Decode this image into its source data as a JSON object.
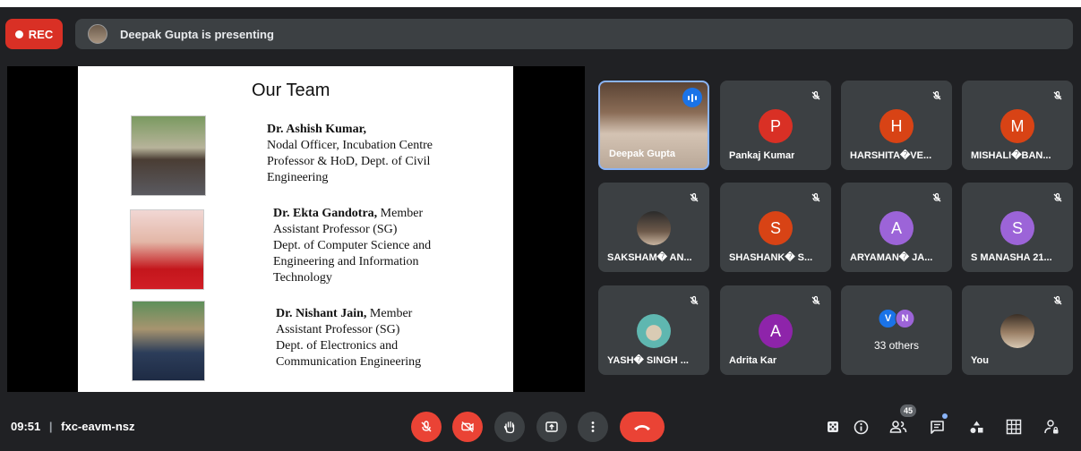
{
  "rec_label": "REC",
  "presenting_text": "Deepak Gupta is presenting",
  "slide": {
    "title": "Our Team",
    "members": [
      {
        "name": "Dr. Ashish Kumar,",
        "role_suffix": "",
        "lines": [
          "Nodal Officer, Incubation Centre",
          "Professor & HoD, Dept. of Civil",
          "Engineering"
        ]
      },
      {
        "name": "Dr. Ekta Gandotra,",
        "role_suffix": " Member",
        "lines": [
          "Assistant Professor (SG)",
          "Dept. of Computer Science and",
          "Engineering and Information",
          "Technology"
        ]
      },
      {
        "name": "Dr. Nishant Jain,",
        "role_suffix": " Member",
        "lines": [
          "Assistant Professor (SG)",
          "Dept. of Electronics and",
          "Communication Engineering"
        ]
      }
    ]
  },
  "participants": [
    {
      "name": "Deepak Gupta",
      "initial": "",
      "color": "",
      "speaking": true
    },
    {
      "name": "Pankaj Kumar",
      "initial": "P",
      "color": "#d93025"
    },
    {
      "name": "HARSHITA�VE...",
      "initial": "H",
      "color": "#d84315"
    },
    {
      "name": "MISHALI�BAN...",
      "initial": "M",
      "color": "#d84315"
    },
    {
      "name": "SAKSHAM� AN...",
      "initial": "",
      "color": ""
    },
    {
      "name": "SHASHANK� S...",
      "initial": "S",
      "color": "#d84315"
    },
    {
      "name": "ARYAMAN� JA...",
      "initial": "A",
      "color": "#9c64d8"
    },
    {
      "name": "S MANASHA 21...",
      "initial": "S",
      "color": "#9c64d8"
    },
    {
      "name": "YASH� SINGH ...",
      "initial": "",
      "color": ""
    },
    {
      "name": "Adrita Kar",
      "initial": "A",
      "color": "#8e24aa"
    },
    {
      "name": "33 others",
      "initials": [
        "V",
        "N"
      ],
      "colors": [
        "#1a73e8",
        "#9c64d8"
      ]
    },
    {
      "name": "You",
      "initial": "",
      "color": ""
    }
  ],
  "footer": {
    "time": "09:51",
    "meeting_code": "fxc-eavm-nsz",
    "participant_count": "45"
  },
  "colors": {
    "end_call": "#ea4335",
    "muted_control": "#ea4335",
    "accent": "#8ab4f8"
  }
}
